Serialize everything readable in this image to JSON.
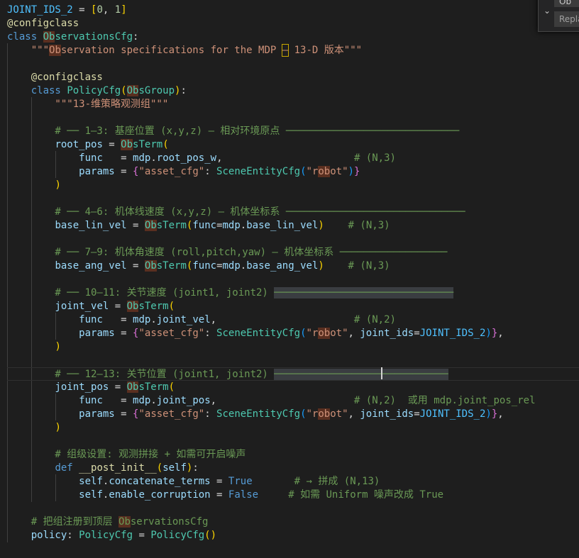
{
  "editor": {
    "lines": [
      {
        "name": "line-joint-ids",
        "text": "JOINT_IDS_2 = [0, 1]"
      },
      {
        "name": "line-decorator-1",
        "text": "@configclass"
      },
      {
        "name": "line-class-observations",
        "text": "class ObservationsCfg:"
      },
      {
        "name": "line-docstring-observations",
        "text": "    \"\"\"Observation specifications for the MDP – 13-D 版本\"\"\""
      },
      {
        "name": "line-blank-1",
        "text": ""
      },
      {
        "name": "line-decorator-2",
        "text": "    @configclass"
      },
      {
        "name": "line-class-policy",
        "text": "    class PolicyCfg(ObsGroup):"
      },
      {
        "name": "line-docstring-policy",
        "text": "        \"\"\"13-维策略观测组\"\"\""
      },
      {
        "name": "line-blank-2",
        "text": ""
      },
      {
        "name": "line-comment-root-pos",
        "text": "        # ── 1–3: 基座位置 (x,y,z) – 相对环境原点 ─────────────────────────────"
      },
      {
        "name": "line-root-pos",
        "text": "        root_pos = ObsTerm("
      },
      {
        "name": "line-root-pos-func",
        "text": "            func   = mdp.root_pos_w,                      # (N,3)"
      },
      {
        "name": "line-root-pos-params",
        "text": "            params = {\"asset_cfg\": SceneEntityCfg(\"robot\")}"
      },
      {
        "name": "line-root-pos-close",
        "text": "        )"
      },
      {
        "name": "line-blank-3",
        "text": ""
      },
      {
        "name": "line-comment-base-lin-vel",
        "text": "        # ── 4–6: 机体线速度 (x,y,z) – 机体坐标系 ──────────────────────────────"
      },
      {
        "name": "line-base-lin-vel",
        "text": "        base_lin_vel = ObsTerm(func=mdp.base_lin_vel)    # (N,3)"
      },
      {
        "name": "line-blank-4",
        "text": ""
      },
      {
        "name": "line-comment-base-ang-vel",
        "text": "        # ── 7–9: 机体角速度 (roll,pitch,yaw) – 机体坐标系 ──────────────────"
      },
      {
        "name": "line-base-ang-vel",
        "text": "        base_ang_vel = ObsTerm(func=mdp.base_ang_vel)    # (N,3)"
      },
      {
        "name": "line-blank-5",
        "text": ""
      },
      {
        "name": "line-comment-joint-vel",
        "text": "        # ── 10–11: 关节速度 (joint1, joint2) ──────────────────────────────"
      },
      {
        "name": "line-joint-vel",
        "text": "        joint_vel = ObsTerm("
      },
      {
        "name": "line-joint-vel-func",
        "text": "            func   = mdp.joint_vel,                       # (N,2)"
      },
      {
        "name": "line-joint-vel-params",
        "text": "            params = {\"asset_cfg\": SceneEntityCfg(\"robot\", joint_ids=JOINT_IDS_2)},"
      },
      {
        "name": "line-joint-vel-close",
        "text": "        )"
      },
      {
        "name": "line-blank-6",
        "text": ""
      },
      {
        "name": "line-comment-joint-pos",
        "text": "        # ── 12–13: 关节位置 (joint1, joint2) ──────────────────────────────"
      },
      {
        "name": "line-joint-pos",
        "text": "        joint_pos = ObsTerm("
      },
      {
        "name": "line-joint-pos-func",
        "text": "            func   = mdp.joint_pos,                       # (N,2)  或用 mdp.joint_pos_rel"
      },
      {
        "name": "line-joint-pos-params",
        "text": "            params = {\"asset_cfg\": SceneEntityCfg(\"robot\", joint_ids=JOINT_IDS_2)},"
      },
      {
        "name": "line-joint-pos-close",
        "text": "        )"
      },
      {
        "name": "line-blank-7",
        "text": ""
      },
      {
        "name": "line-comment-group",
        "text": "        # 组级设置: 观测拼接 + 如需可开启噪声"
      },
      {
        "name": "line-def-post-init",
        "text": "        def __post_init__(self):"
      },
      {
        "name": "line-concatenate",
        "text": "            self.concatenate_terms = True       # → 拼成 (N,13)"
      },
      {
        "name": "line-enable-corruption",
        "text": "            self.enable_corruption = False      # 如需 Uniform 噪声改成 True"
      },
      {
        "name": "line-blank-8",
        "text": ""
      },
      {
        "name": "line-comment-register",
        "text": "    # 把组注册到顶层 ObservationsCfg"
      },
      {
        "name": "line-policy-assign",
        "text": "    policy: PolicyCfg = PolicyCfg()"
      }
    ]
  },
  "find_widget": {
    "toggle_icon": "chevron-down-icon",
    "toggle_glyph": "⌄",
    "find_value": "Ob",
    "replace_placeholder": "Replace"
  },
  "colors": {
    "background": "#1e1e1e",
    "keyword": "#569cd6",
    "function": "#dcdcaa",
    "class": "#4ec9b0",
    "string": "#ce9178",
    "comment": "#6a9955",
    "match_highlight": "#5a2f20"
  }
}
